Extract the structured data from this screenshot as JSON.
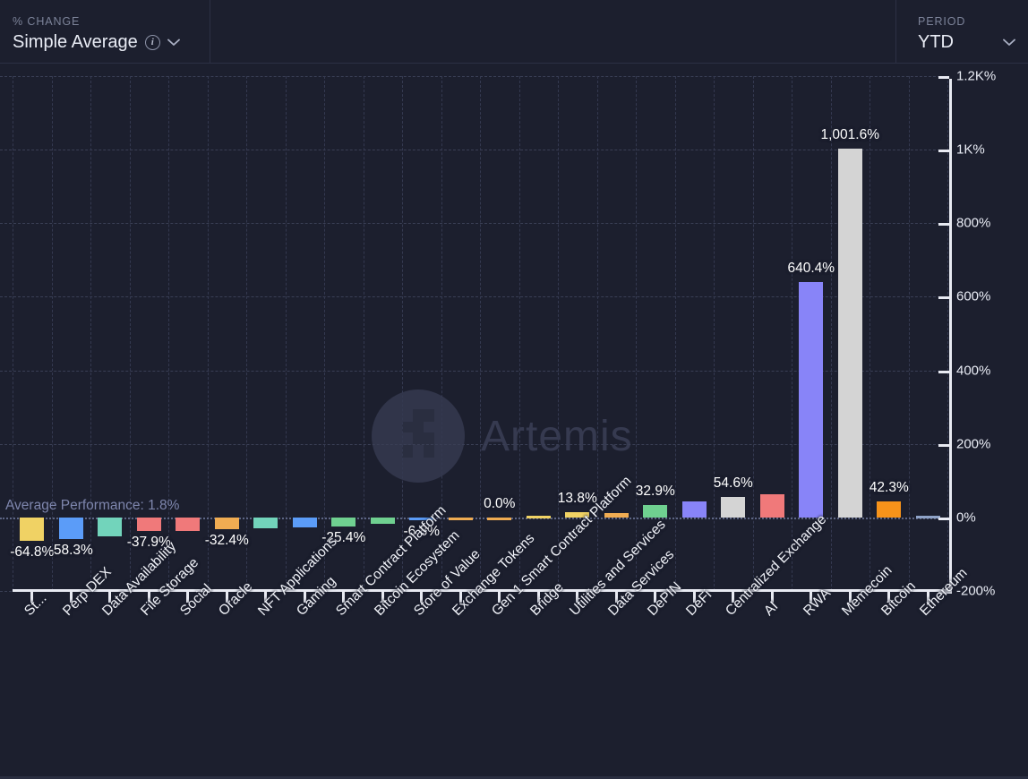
{
  "header": {
    "metric_control": {
      "label": "% CHANGE",
      "value": "Simple Average",
      "info_icon": "info-icon",
      "chevron_icon": "chevron-down-icon"
    },
    "period_control": {
      "label": "PERIOD",
      "value": "YTD",
      "chevron_icon": "chevron-down-icon"
    }
  },
  "watermark": {
    "text": "Artemis",
    "logo": "artemis-logo-icon"
  },
  "annotation": {
    "average_performance": "Average Performance: 1.8%",
    "average_value": 1.8
  },
  "chart_data": {
    "type": "bar",
    "title": "",
    "xlabel": "",
    "ylabel": "",
    "ylim": [
      -200,
      1200
    ],
    "grid": true,
    "legend": null,
    "ytick_labels": [
      "1.2K%",
      "1K%",
      "800%",
      "600%",
      "400%",
      "200%",
      "0%",
      "-200%"
    ],
    "ytick_values": [
      1200,
      1000,
      800,
      600,
      400,
      200,
      0,
      -200
    ],
    "value_suffix": "%",
    "categories": [
      "St...",
      "Perp DEX",
      "Data Availability",
      "File Storage",
      "Social",
      "Oracle",
      "NFT Applications",
      "Gaming",
      "Smart Contract Platform",
      "Bitcoin Ecosystem",
      "Store of Value",
      "Exchange Tokens",
      "Gen 1 Smart Contract Platform",
      "Bridge",
      "Utilities and Services",
      "Data Services",
      "DePIN",
      "DeFi",
      "Centralized Exchange",
      "AI",
      "RWA",
      "Memecoin",
      "Bitcoin",
      "Ethereum"
    ],
    "values": [
      -64.8,
      -58.3,
      -50.5,
      -37.9,
      -37.5,
      -32.4,
      -29.5,
      -27.5,
      -25.4,
      -17.5,
      -6.8,
      -4.5,
      0.0,
      3.5,
      13.8,
      13.0,
      32.9,
      43.5,
      54.6,
      62.0,
      640.4,
      1001.6,
      42.3,
      4.5
    ],
    "colors": [
      "#f0d264",
      "#5b9cf8",
      "#72d4bb",
      "#f0797a",
      "#f0797a",
      "#f0ac52",
      "#72d4bb",
      "#5b9cf8",
      "#6fd090",
      "#6fd090",
      "#5b9cf8",
      "#f0ac52",
      "#f0ac52",
      "#f0d264",
      "#f0d264",
      "#f0ac52",
      "#6fd090",
      "#8884f8",
      "#d4d4d4",
      "#f0797a",
      "#8884f8",
      "#d4d4d4",
      "#f7931a",
      "#8fa3c8"
    ],
    "labeled_points": [
      {
        "category": "St...",
        "label": "-64.8%"
      },
      {
        "category": "Perp DEX",
        "label": "-58.3%"
      },
      {
        "category": "File Storage",
        "label": "-37.9%"
      },
      {
        "category": "Oracle",
        "label": "-32.4%"
      },
      {
        "category": "Smart Contract Platform",
        "label": "-25.4%"
      },
      {
        "category": "Store of Value",
        "label": "-6.8%"
      },
      {
        "category": "Gen 1 Smart Contract Platform",
        "label": "0.0%"
      },
      {
        "category": "Utilities and Services",
        "label": "13.8%"
      },
      {
        "category": "DePIN",
        "label": "32.9%"
      },
      {
        "category": "Centralized Exchange",
        "label": "54.6%"
      },
      {
        "category": "RWA",
        "label": "640.4%"
      },
      {
        "category": "Memecoin",
        "label": "1,001.6%"
      },
      {
        "category": "Bitcoin",
        "label": "42.3%"
      }
    ]
  },
  "palette": {
    "background": "#1c1f2e",
    "grid": "#3a3f55",
    "axis": "#e8eaf2",
    "text": "#e9ecf5",
    "muted_text": "#7c8399",
    "average_line": "#5d6584"
  }
}
